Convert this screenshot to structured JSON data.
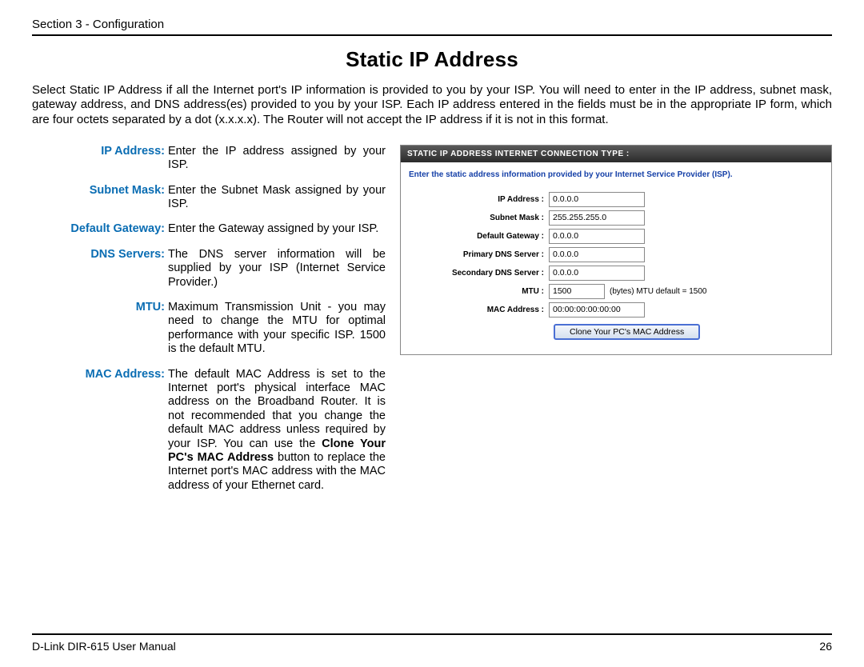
{
  "header": {
    "section_text": "Section 3 - Configuration"
  },
  "title": "Static IP Address",
  "intro": "Select Static IP Address if all the Internet port's IP information is provided to you by your ISP. You will need to enter in the IP address, subnet mask, gateway address, and DNS address(es) provided to you by your ISP. Each IP address entered in the fields must be in the appropriate IP form, which are four octets separated by a dot (x.x.x.x). The Router will not accept the IP address if it is not in this format.",
  "definitions": {
    "ip_address": {
      "label": "IP Address:",
      "desc": "Enter the IP address assigned by your ISP."
    },
    "subnet_mask": {
      "label": "Subnet Mask:",
      "desc": "Enter the Subnet Mask assigned by your ISP."
    },
    "default_gateway": {
      "label": "Default Gateway:",
      "desc": "Enter the Gateway assigned by your ISP."
    },
    "dns_servers": {
      "label": "DNS Servers:",
      "desc": "The DNS server information will be supplied by your ISP (Internet Service Provider.)"
    },
    "mtu": {
      "label": "MTU:",
      "desc": "Maximum Transmission Unit - you may need to change the MTU for optimal performance with your specific ISP. 1500 is the default MTU."
    },
    "mac_address": {
      "label": "MAC Address:",
      "desc_pre": "The default MAC Address is set to the Internet port's physical interface MAC address on the Broadband Router. It is not recommended that you change the default MAC address unless required by your ISP.  You can use the ",
      "desc_bold": "Clone Your PC's MAC Address",
      "desc_post": " button to replace the Internet port's MAC address with the MAC address of your Ethernet card."
    }
  },
  "panel": {
    "header": "STATIC IP ADDRESS INTERNET CONNECTION TYPE :",
    "instruction": "Enter the static address information provided by your Internet Service Provider (ISP).",
    "fields": {
      "ip_address": {
        "label": "IP Address :",
        "value": "0.0.0.0"
      },
      "subnet_mask": {
        "label": "Subnet Mask :",
        "value": "255.255.255.0"
      },
      "default_gateway": {
        "label": "Default Gateway :",
        "value": "0.0.0.0"
      },
      "primary_dns": {
        "label": "Primary DNS Server :",
        "value": "0.0.0.0"
      },
      "secondary_dns": {
        "label": "Secondary DNS Server :",
        "value": "0.0.0.0"
      },
      "mtu": {
        "label": "MTU :",
        "value": "1500",
        "extra": "(bytes)   MTU default = 1500"
      },
      "mac_address": {
        "label": "MAC Address :",
        "value": "00:00:00:00:00:00"
      }
    },
    "clone_button": "Clone Your PC's MAC Address"
  },
  "footer": {
    "left": "D-Link DIR-615 User Manual",
    "page": "26"
  }
}
